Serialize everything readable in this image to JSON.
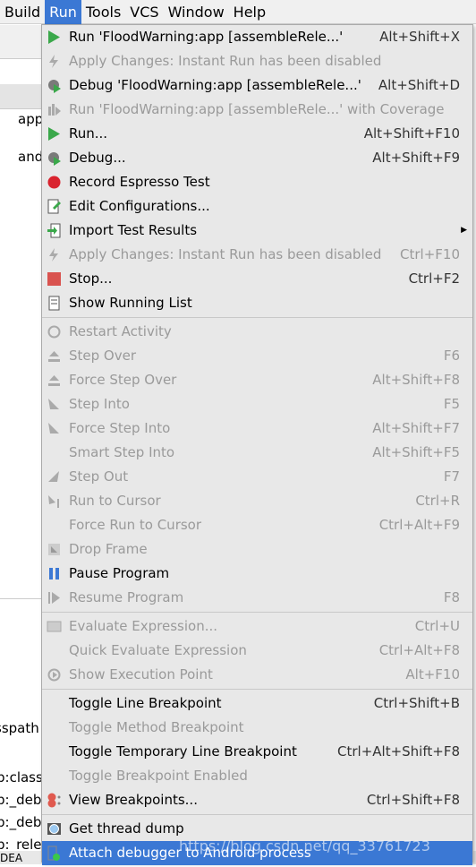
{
  "menubar": [
    "Build",
    "Run",
    "Tools",
    "VCS",
    "Window",
    "Help"
  ],
  "active_menu": "Run",
  "editor_fragments": [
    "app",
    "and"
  ],
  "bottom_fragments": [
    "sspath",
    "p:class",
    "p:_deb",
    "p:_deb",
    "p:_rele",
    "DEA"
  ],
  "accent": "#3b78d4",
  "groups": [
    [
      {
        "label": "Run 'FloodWarning:app [assembleRele...'",
        "shortcut": "Alt+Shift+X",
        "icon": "run-icon"
      },
      {
        "label": "Apply Changes: Instant Run has been disabled",
        "shortcut": "",
        "icon": "lightning-icon",
        "disabled": true
      },
      {
        "label": "Debug 'FloodWarning:app [assembleRele...'",
        "shortcut": "Alt+Shift+D",
        "icon": "debug-icon"
      },
      {
        "label": "Run 'FloodWarning:app [assembleRele...' with Coverage",
        "shortcut": "",
        "icon": "coverage-icon",
        "disabled": true
      },
      {
        "label": "Run...",
        "shortcut": "Alt+Shift+F10",
        "icon": "run-icon"
      },
      {
        "label": "Debug...",
        "shortcut": "Alt+Shift+F9",
        "icon": "debug-icon"
      },
      {
        "label": "Record Espresso Test",
        "shortcut": "",
        "icon": "record-icon"
      },
      {
        "label": "Edit Configurations...",
        "shortcut": "",
        "icon": "edit-config-icon"
      },
      {
        "label": "Import Test Results",
        "shortcut": "",
        "icon": "import-icon",
        "submenu": true
      },
      {
        "label": "Apply Changes: Instant Run has been disabled",
        "shortcut": "Ctrl+F10",
        "icon": "lightning-icon",
        "disabled": true
      },
      {
        "label": "Stop...",
        "shortcut": "Ctrl+F2",
        "icon": "stop-icon"
      },
      {
        "label": "Show Running List",
        "shortcut": "",
        "icon": "list-icon"
      }
    ],
    [
      {
        "label": "Restart Activity",
        "shortcut": "",
        "icon": "restart-icon",
        "disabled": true
      },
      {
        "label": "Step Over",
        "shortcut": "F6",
        "icon": "step-over-icon",
        "disabled": true
      },
      {
        "label": "Force Step Over",
        "shortcut": "Alt+Shift+F8",
        "icon": "force-step-over-icon",
        "disabled": true
      },
      {
        "label": "Step Into",
        "shortcut": "F5",
        "icon": "step-into-icon",
        "disabled": true
      },
      {
        "label": "Force Step Into",
        "shortcut": "Alt+Shift+F7",
        "icon": "force-step-into-icon",
        "disabled": true
      },
      {
        "label": "Smart Step Into",
        "shortcut": "Alt+Shift+F5",
        "icon": "",
        "disabled": true
      },
      {
        "label": "Step Out",
        "shortcut": "F7",
        "icon": "step-out-icon",
        "disabled": true
      },
      {
        "label": "Run to Cursor",
        "shortcut": "Ctrl+R",
        "icon": "run-to-cursor-icon",
        "disabled": true
      },
      {
        "label": "Force Run to Cursor",
        "shortcut": "Ctrl+Alt+F9",
        "icon": "",
        "disabled": true
      },
      {
        "label": "Drop Frame",
        "shortcut": "",
        "icon": "drop-frame-icon",
        "disabled": true
      },
      {
        "label": "Pause Program",
        "shortcut": "",
        "icon": "pause-icon"
      },
      {
        "label": "Resume Program",
        "shortcut": "F8",
        "icon": "resume-icon",
        "disabled": true
      }
    ],
    [
      {
        "label": "Evaluate Expression...",
        "shortcut": "Ctrl+U",
        "icon": "evaluate-icon",
        "disabled": true
      },
      {
        "label": "Quick Evaluate Expression",
        "shortcut": "Ctrl+Alt+F8",
        "icon": "",
        "disabled": true
      },
      {
        "label": "Show Execution Point",
        "shortcut": "Alt+F10",
        "icon": "execution-point-icon",
        "disabled": true
      }
    ],
    [
      {
        "label": "Toggle Line Breakpoint",
        "shortcut": "Ctrl+Shift+B",
        "icon": ""
      },
      {
        "label": "Toggle Method Breakpoint",
        "shortcut": "",
        "icon": "",
        "disabled": true
      },
      {
        "label": "Toggle Temporary Line Breakpoint",
        "shortcut": "Ctrl+Alt+Shift+F8",
        "icon": ""
      },
      {
        "label": "Toggle Breakpoint Enabled",
        "shortcut": "",
        "icon": "",
        "disabled": true
      },
      {
        "label": "View Breakpoints...",
        "shortcut": "Ctrl+Shift+F8",
        "icon": "breakpoints-icon"
      }
    ],
    [
      {
        "label": "Get thread dump",
        "shortcut": "",
        "icon": "camera-icon"
      },
      {
        "label": "Attach debugger to Android process",
        "shortcut": "",
        "icon": "attach-debugger-icon",
        "highlighted": true
      }
    ]
  ],
  "watermark": "https://blog.csdn.net/qq_33761723"
}
